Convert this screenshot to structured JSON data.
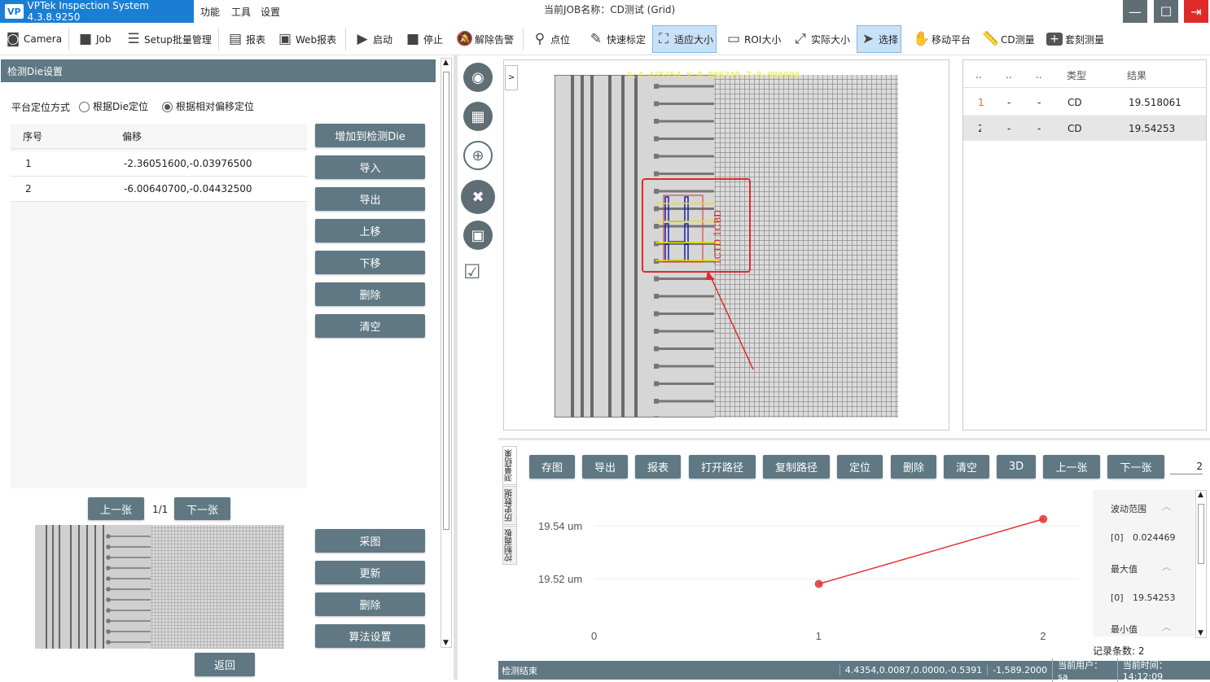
{
  "app": {
    "title": "VPTek Inspection System 4.3.8.9250",
    "logo": "VP",
    "job_label": "当前JOB名称：CD测试 (Grid)"
  },
  "menu": [
    "功能",
    "工具",
    "设置"
  ],
  "toolbar": [
    {
      "label": "Camera",
      "icon": "camera-icon"
    },
    {
      "label": "Job",
      "icon": "briefcase-icon"
    },
    {
      "label": "Setup批量管理",
      "icon": "checklist-icon"
    },
    {
      "label": "报表",
      "icon": "document-icon"
    },
    {
      "label": "Web报表",
      "icon": "globe-icon"
    },
    {
      "label": "启动",
      "icon": "play-icon"
    },
    {
      "label": "停止",
      "icon": "stop-icon"
    },
    {
      "label": "解除告警",
      "icon": "bell-off-icon"
    },
    {
      "label": "点位",
      "icon": "pin-icon"
    },
    {
      "label": "快速标定",
      "icon": "wrench-icon"
    },
    {
      "label": "适应大小",
      "icon": "fit-icon"
    },
    {
      "label": "ROI大小",
      "icon": "rect-icon"
    },
    {
      "label": "实际大小",
      "icon": "expand-icon"
    },
    {
      "label": "选择",
      "icon": "cursor-icon"
    },
    {
      "label": "移动平台",
      "icon": "hand-icon"
    },
    {
      "label": "CD测量",
      "icon": "ruler-icon"
    },
    {
      "label": "套刻测量",
      "icon": "plus-icon"
    }
  ],
  "left": {
    "header": "检测Die设置",
    "mode_label": "平台定位方式",
    "radio_die": "根据Die定位",
    "radio_offset": "根据相对偏移定位",
    "col_seq": "序号",
    "col_offset": "偏移",
    "rows": [
      {
        "seq": "1",
        "offset": "-2.36051600,-0.03976500"
      },
      {
        "seq": "2",
        "offset": "-6.00640700,-0.04432500"
      }
    ],
    "buttons": [
      "增加到检测Die",
      "导入",
      "导出",
      "上移",
      "下移",
      "删除",
      "清空"
    ],
    "prev": "上一张",
    "page": "1/1",
    "next": "下一张",
    "buttons2": [
      "采图",
      "更新",
      "删除",
      "算法设置"
    ],
    "back": "返回"
  },
  "image": {
    "coord_text": "X:4.435354,Y:0.008740,Z:0.000000",
    "roi_label": "1CTD 1CBD",
    "expand_label": ">"
  },
  "results": {
    "headers": [
      "..",
      "..",
      "..",
      "类型",
      "结果"
    ],
    "rows": [
      [
        "1",
        "-",
        "-",
        "CD",
        "19.518061"
      ],
      [
        "2",
        "-",
        "-",
        "CD",
        "19.54253"
      ]
    ]
  },
  "actions": [
    "存图",
    "导出",
    "报表",
    "打开路径",
    "复制路径",
    "定位",
    "删除",
    "清空",
    "3D",
    "上一张",
    "下一张"
  ],
  "action_count": "2",
  "vtabs": [
    "测量结果",
    "历史数据",
    "控制面板"
  ],
  "chart_data": {
    "type": "line",
    "x": [
      1,
      2
    ],
    "values": [
      19.518061,
      19.54253
    ],
    "xticks": [
      "0",
      "1",
      "2"
    ],
    "yticks": [
      "19.54 um",
      "19.52 um"
    ],
    "ylim": [
      19.505,
      19.548
    ],
    "xlim": [
      0,
      2.05
    ],
    "color": "#e0302c"
  },
  "stats": [
    {
      "title": "波动范围",
      "index": "[0]",
      "value": "0.024469"
    },
    {
      "title": "最大值",
      "index": "[0]",
      "value": "19.54253"
    },
    {
      "title": "最小值",
      "index": "",
      "value": ""
    }
  ],
  "record_count": "记录条数: 2",
  "status": {
    "left": "检测结束",
    "coords": "4.4354,0.0087,0.0000,-0.5391",
    "pos": "-1,589.2000",
    "user": "当前用户： sa",
    "time": "当前时间： 14:12:09"
  }
}
